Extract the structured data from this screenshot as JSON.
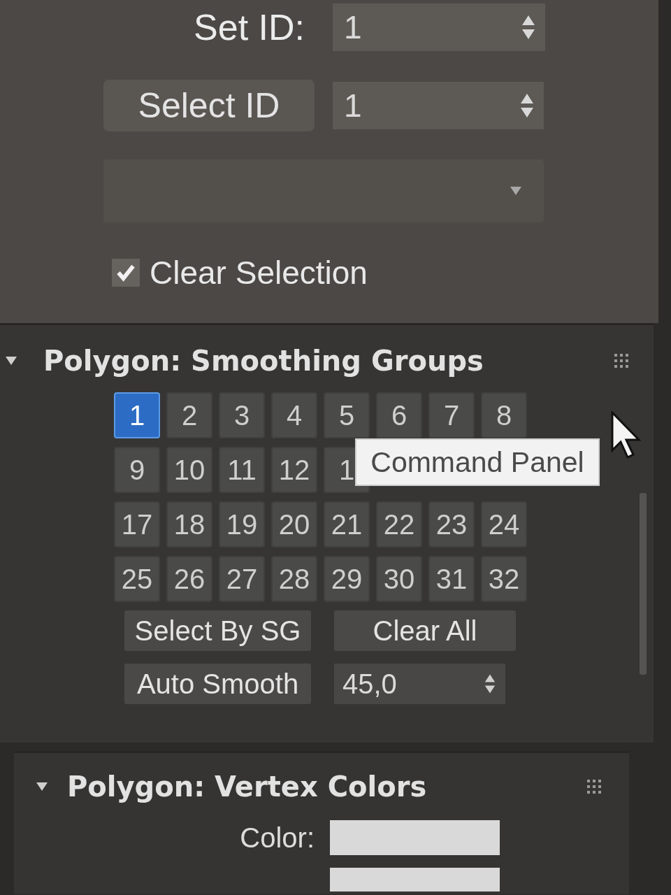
{
  "material_id": {
    "set_id_label": "Set ID:",
    "set_id_value": "1",
    "select_id_button": "Select ID",
    "select_id_value": "1"
  },
  "clear_selection": {
    "label": "Clear Selection",
    "checked": true
  },
  "smoothing_groups": {
    "title": "Polygon: Smoothing Groups",
    "expanded": true,
    "group_rows": [
      [
        {
          "label": "1",
          "selected": true
        },
        {
          "label": "2",
          "selected": false
        },
        {
          "label": "3",
          "selected": false
        },
        {
          "label": "4",
          "selected": false
        },
        {
          "label": "5",
          "selected": false
        },
        {
          "label": "6",
          "selected": false
        },
        {
          "label": "7",
          "selected": false
        },
        {
          "label": "8",
          "selected": false
        }
      ],
      [
        {
          "label": "9",
          "selected": false
        },
        {
          "label": "10",
          "selected": false
        },
        {
          "label": "11",
          "selected": false
        },
        {
          "label": "12",
          "selected": false
        },
        {
          "label": "1",
          "selected": false
        }
      ],
      [
        {
          "label": "17",
          "selected": false
        },
        {
          "label": "18",
          "selected": false
        },
        {
          "label": "19",
          "selected": false
        },
        {
          "label": "20",
          "selected": false
        },
        {
          "label": "21",
          "selected": false
        },
        {
          "label": "22",
          "selected": false
        },
        {
          "label": "23",
          "selected": false
        },
        {
          "label": "24",
          "selected": false
        }
      ],
      [
        {
          "label": "25",
          "selected": false
        },
        {
          "label": "26",
          "selected": false
        },
        {
          "label": "27",
          "selected": false
        },
        {
          "label": "28",
          "selected": false
        },
        {
          "label": "29",
          "selected": false
        },
        {
          "label": "30",
          "selected": false
        },
        {
          "label": "31",
          "selected": false
        },
        {
          "label": "32",
          "selected": false
        }
      ]
    ],
    "tooltip": "Command Panel",
    "buttons": [
      "Select By SG",
      "Clear All"
    ],
    "auto_smooth": {
      "button": "Auto Smooth",
      "value": "45,0"
    }
  },
  "vertex_colors": {
    "title": "Polygon: Vertex Colors",
    "expanded": true,
    "swatches": [
      {
        "label": "Color:",
        "color": "#d9d9d9"
      },
      {
        "color": "#d9d9d9"
      }
    ]
  }
}
